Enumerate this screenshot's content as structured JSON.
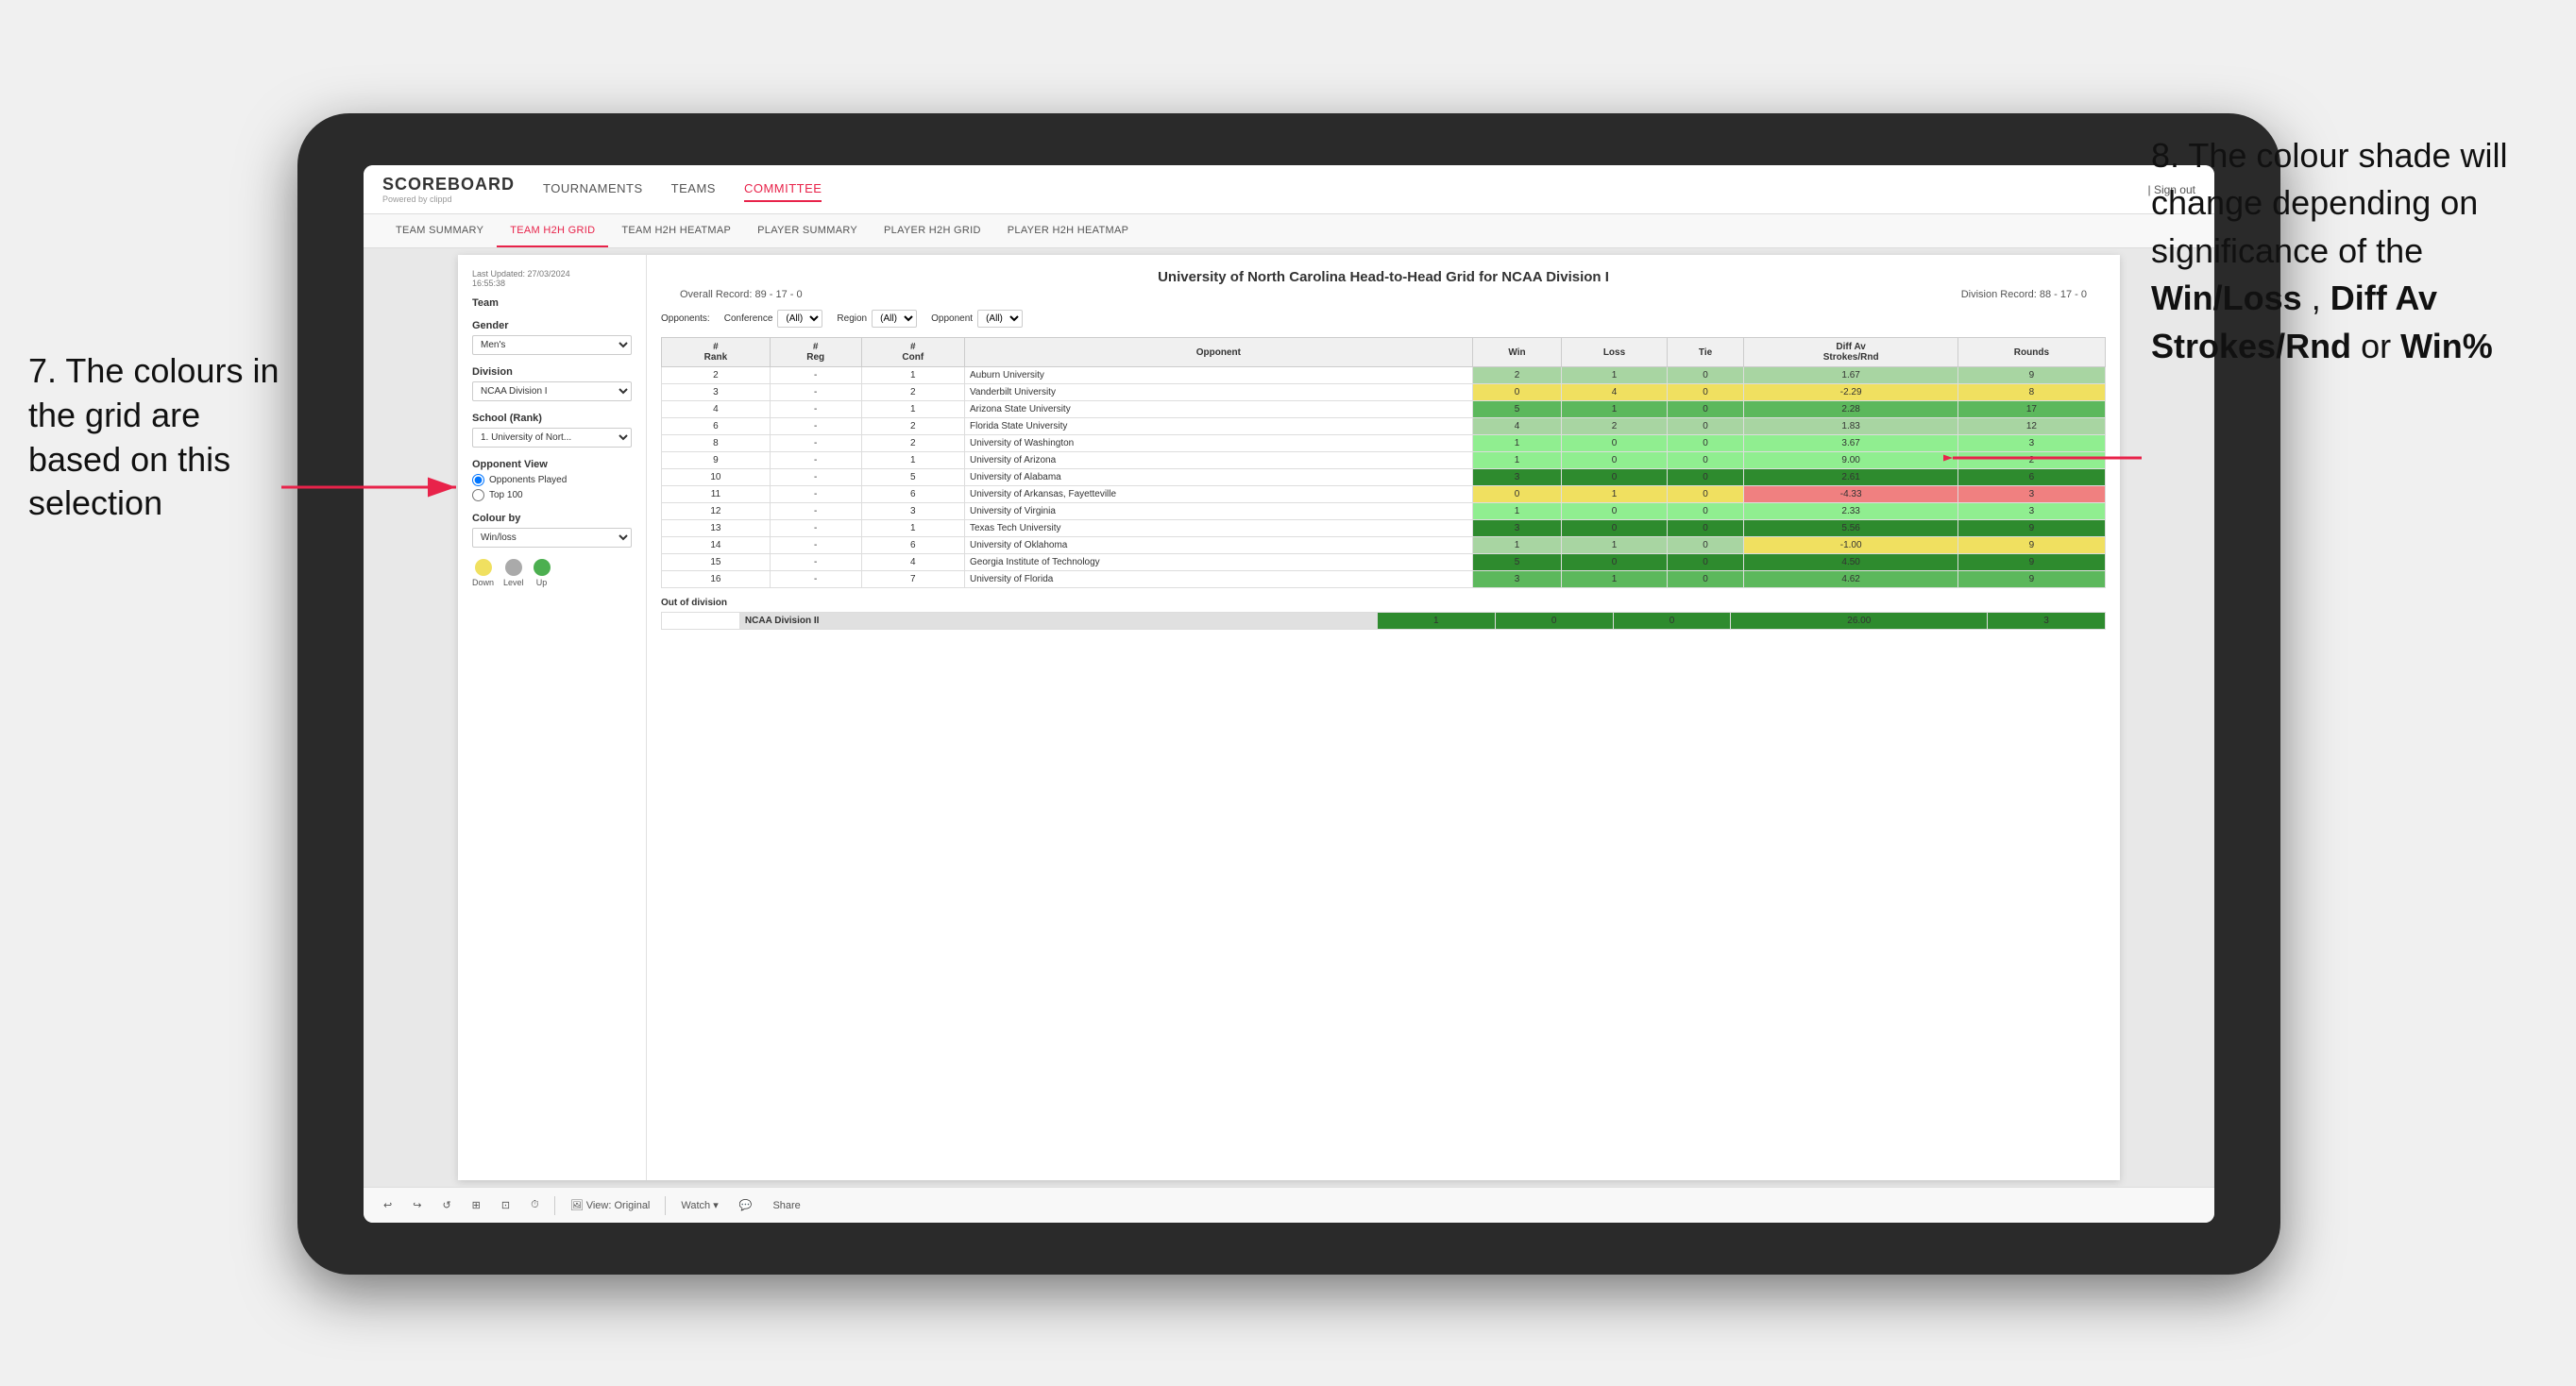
{
  "annotations": {
    "left_text": "7. The colours in the grid are based on this selection",
    "right_text_prefix": "8. The colour shade will change depending on significance of the ",
    "right_bold1": "Win/Loss",
    "right_text_mid1": ", ",
    "right_bold2": "Diff Av Strokes/Rnd",
    "right_text_mid2": " or ",
    "right_bold3": "Win%"
  },
  "nav": {
    "logo": "SCOREBOARD",
    "logo_sub": "Powered by clippd",
    "items": [
      "TOURNAMENTS",
      "TEAMS",
      "COMMITTEE"
    ],
    "active_item": "COMMITTEE",
    "sign_out": "Sign out"
  },
  "sub_nav": {
    "items": [
      "TEAM SUMMARY",
      "TEAM H2H GRID",
      "TEAM H2H HEATMAP",
      "PLAYER SUMMARY",
      "PLAYER H2H GRID",
      "PLAYER H2H HEATMAP"
    ],
    "active": "TEAM H2H GRID"
  },
  "sidebar": {
    "last_updated_label": "Last Updated: 27/03/2024",
    "last_updated_time": "16:55:38",
    "team_label": "Team",
    "gender_label": "Gender",
    "gender_value": "Men's",
    "division_label": "Division",
    "division_value": "NCAA Division I",
    "school_label": "School (Rank)",
    "school_value": "1. University of Nort...",
    "opponent_view_label": "Opponent View",
    "radio1": "Opponents Played",
    "radio2": "Top 100",
    "colour_by_label": "Colour by",
    "colour_by_value": "Win/loss",
    "legend_down": "Down",
    "legend_level": "Level",
    "legend_up": "Up"
  },
  "grid": {
    "title": "University of North Carolina Head-to-Head Grid for NCAA Division I",
    "overall_record_label": "Overall Record:",
    "overall_record": "89 - 17 - 0",
    "division_record_label": "Division Record:",
    "division_record": "88 - 17 - 0",
    "filter_conference_label": "Conference",
    "filter_conference_value": "(All)",
    "filter_region_label": "Region",
    "filter_region_value": "(All)",
    "filter_opponent_label": "Opponent",
    "filter_opponent_value": "(All)",
    "filter_opponents_label": "Opponents:",
    "columns": [
      "#\nRank",
      "#\nReg",
      "#\nConf",
      "Opponent",
      "Win",
      "Loss",
      "Tie",
      "Diff Av\nStrokes/Rnd",
      "Rounds"
    ],
    "rows": [
      {
        "rank": "2",
        "reg": "-",
        "conf": "1",
        "opponent": "Auburn University",
        "win": "2",
        "loss": "1",
        "tie": "0",
        "diff": "1.67",
        "rounds": "9",
        "win_color": "green-light",
        "diff_color": "green-light"
      },
      {
        "rank": "3",
        "reg": "-",
        "conf": "2",
        "opponent": "Vanderbilt University",
        "win": "0",
        "loss": "4",
        "tie": "0",
        "diff": "-2.29",
        "rounds": "8",
        "win_color": "yellow",
        "diff_color": "yellow"
      },
      {
        "rank": "4",
        "reg": "-",
        "conf": "1",
        "opponent": "Arizona State University",
        "win": "5",
        "loss": "1",
        "tie": "0",
        "diff": "2.28",
        "rounds": "17",
        "win_color": "green-mid",
        "diff_color": "green-mid"
      },
      {
        "rank": "6",
        "reg": "-",
        "conf": "2",
        "opponent": "Florida State University",
        "win": "4",
        "loss": "2",
        "tie": "0",
        "diff": "1.83",
        "rounds": "12",
        "win_color": "green-light",
        "diff_color": "green-light"
      },
      {
        "rank": "8",
        "reg": "-",
        "conf": "2",
        "opponent": "University of Washington",
        "win": "1",
        "loss": "0",
        "tie": "0",
        "diff": "3.67",
        "rounds": "3",
        "win_color": "green-plain",
        "diff_color": "green-plain"
      },
      {
        "rank": "9",
        "reg": "-",
        "conf": "1",
        "opponent": "University of Arizona",
        "win": "1",
        "loss": "0",
        "tie": "0",
        "diff": "9.00",
        "rounds": "2",
        "win_color": "green-plain",
        "diff_color": "green-plain"
      },
      {
        "rank": "10",
        "reg": "-",
        "conf": "5",
        "opponent": "University of Alabama",
        "win": "3",
        "loss": "0",
        "tie": "0",
        "diff": "2.61",
        "rounds": "6",
        "win_color": "green-dark",
        "diff_color": "green-dark",
        "highlight": true
      },
      {
        "rank": "11",
        "reg": "-",
        "conf": "6",
        "opponent": "University of Arkansas, Fayetteville",
        "win": "0",
        "loss": "1",
        "tie": "0",
        "diff": "-4.33",
        "rounds": "3",
        "win_color": "yellow",
        "diff_color": "red-light"
      },
      {
        "rank": "12",
        "reg": "-",
        "conf": "3",
        "opponent": "University of Virginia",
        "win": "1",
        "loss": "0",
        "tie": "0",
        "diff": "2.33",
        "rounds": "3",
        "win_color": "green-plain",
        "diff_color": "green-plain"
      },
      {
        "rank": "13",
        "reg": "-",
        "conf": "1",
        "opponent": "Texas Tech University",
        "win": "3",
        "loss": "0",
        "tie": "0",
        "diff": "5.56",
        "rounds": "9",
        "win_color": "green-dark",
        "diff_color": "green-dark"
      },
      {
        "rank": "14",
        "reg": "-",
        "conf": "6",
        "opponent": "University of Oklahoma",
        "win": "1",
        "loss": "1",
        "tie": "0",
        "diff": "-1.00",
        "rounds": "9",
        "win_color": "green-light",
        "diff_color": "yellow"
      },
      {
        "rank": "15",
        "reg": "-",
        "conf": "4",
        "opponent": "Georgia Institute of Technology",
        "win": "5",
        "loss": "0",
        "tie": "0",
        "diff": "4.50",
        "rounds": "9",
        "win_color": "green-dark",
        "diff_color": "green-dark"
      },
      {
        "rank": "16",
        "reg": "-",
        "conf": "7",
        "opponent": "University of Florida",
        "win": "3",
        "loss": "1",
        "tie": "0",
        "diff": "4.62",
        "rounds": "9",
        "win_color": "green-mid",
        "diff_color": "green-mid"
      }
    ],
    "out_of_division_label": "Out of division",
    "out_of_division_row": {
      "label": "NCAA Division II",
      "win": "1",
      "loss": "0",
      "tie": "0",
      "diff": "26.00",
      "rounds": "3",
      "diff_color": "green-dark"
    }
  },
  "toolbar": {
    "view_label": "View: Original",
    "watch_label": "Watch ▾",
    "share_label": "Share"
  }
}
